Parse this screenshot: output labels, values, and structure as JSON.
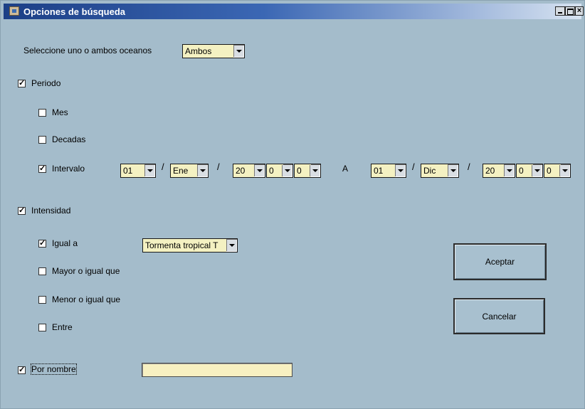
{
  "window": {
    "title": "Opciones de búsqueda",
    "controls": {
      "minimize": "minimize",
      "maximize": "maximize",
      "close": "×"
    }
  },
  "oceans": {
    "label": "Seleccione uno o ambos oceanos",
    "value": "Ambos"
  },
  "periodo": {
    "label": "Periodo",
    "checked": true,
    "mes": {
      "label": "Mes",
      "checked": false
    },
    "decadas": {
      "label": "Decadas",
      "checked": false
    },
    "intervalo": {
      "label": "Intervalo",
      "checked": true,
      "separator": "/",
      "to_label": "A",
      "from": {
        "day": "01",
        "month": "Ene",
        "year_a": "20",
        "year_b": "0",
        "year_c": "0"
      },
      "to": {
        "day": "01",
        "month": "Dic",
        "year_a": "20",
        "year_b": "0",
        "year_c": "0"
      }
    }
  },
  "intensidad": {
    "label": "Intensidad",
    "checked": true,
    "igual": {
      "label": "Igual a",
      "checked": true,
      "value": "Tormenta tropical T"
    },
    "mayor": {
      "label": "Mayor o igual que",
      "checked": false
    },
    "menor": {
      "label": "Menor o igual que",
      "checked": false
    },
    "entre": {
      "label": "Entre",
      "checked": false
    }
  },
  "nombre": {
    "label": "Por nombre",
    "checked": true,
    "value": ""
  },
  "buttons": {
    "accept": "Aceptar",
    "cancel": "Cancelar"
  }
}
